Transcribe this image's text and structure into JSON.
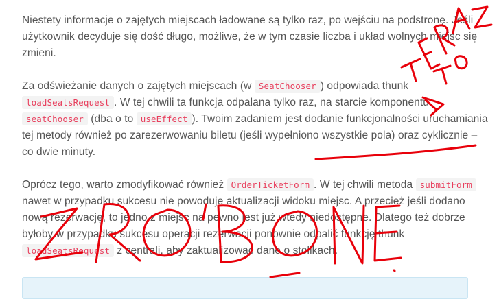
{
  "article": {
    "p1": "Niestety informacje o zajętych miejscach ładowane są tylko raz, po wejściu na podstronę. Jeśli użytkownik decyduje się dość długo, możliwe, że w tym czasie liczba i układ wolnych miejsc się zmieni.",
    "p2": {
      "t1": "Za odświeżanie danych o zajętych miejscach (w ",
      "c1": "SeatChooser",
      "t2": ") odpowiada thunk ",
      "c2": "loadSeatsRequest",
      "t3": ". W tej chwili ta funkcja odpalana tylko raz, na starcie komponentu ",
      "c3": "seatChooser",
      "t4": " (dba o to ",
      "c4": "useEffect",
      "t5": "). Twoim zadaniem jest dodanie funkcjonalności uruchamiania tej metody również po zarezerwowaniu biletu (jeśli wypełniono wszystkie pola) oraz cyklicznie – co dwie minuty."
    },
    "p3": {
      "t1": "Oprócz tego, warto zmodyfikować również ",
      "c1": "OrderTicketForm",
      "t2": ". W tej chwili metoda ",
      "c2": "submitForm",
      "t3": " nawet w przypadku sukcesu nie powoduje aktualizacji widoku miejsc. A przecież jeśli dodano nową rezerwację, to jedno z miejsc na pewno jest już wtedy niedostępne. Dlatego też dobrze byłoby w przypadku sukcesu operacji rezerwacji ponownie odpalić funkcję thunk ",
      "c3": "loadSeatsRequest",
      "t4": " z centrali, aby zaktualizować dane o stolikach."
    }
  },
  "annotations": {
    "handwriting_1": "TERAZ TO",
    "handwriting_2": "ZROBIONE",
    "ink_color": "#e8000a"
  },
  "colors": {
    "code_text": "#e83e5c",
    "code_bg": "#f3f3f3",
    "body_text": "#555555",
    "callout_bg": "#e6f3fa"
  }
}
